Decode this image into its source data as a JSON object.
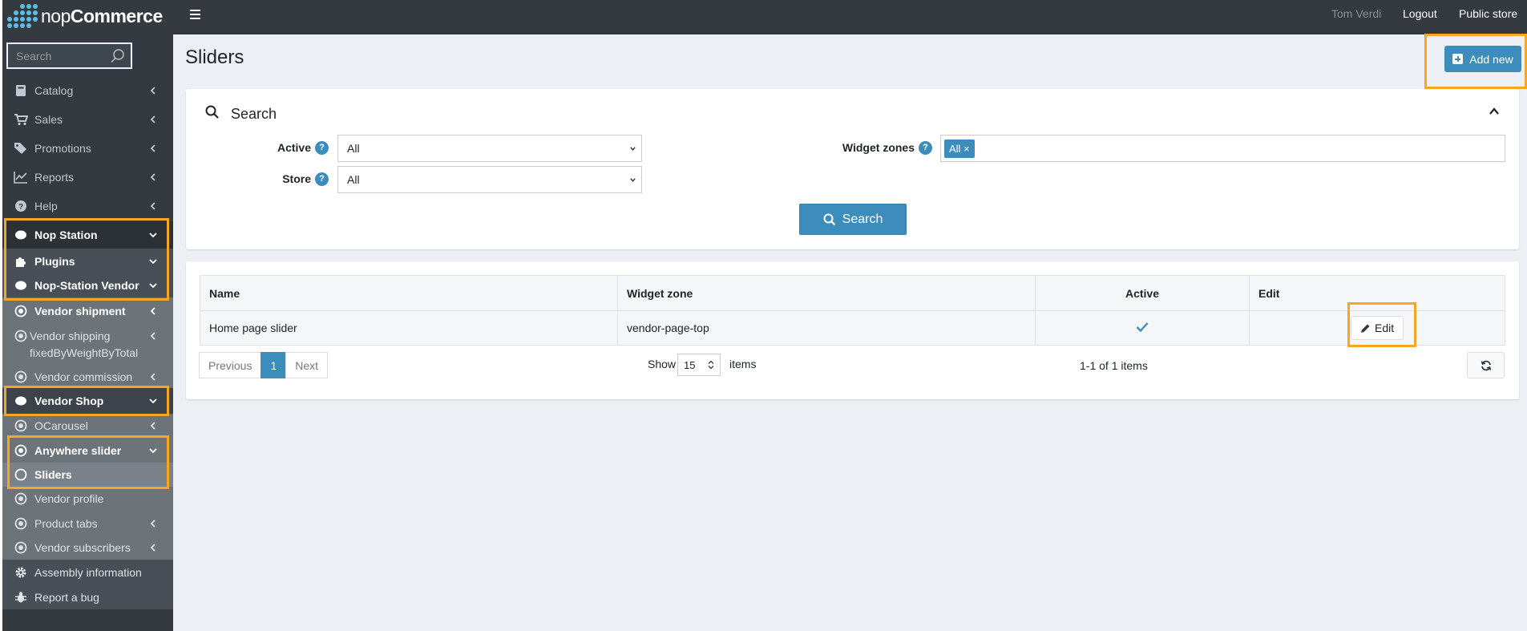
{
  "brand": {
    "logo_light": "nop",
    "logo_bold": "Commerce"
  },
  "sidebar": {
    "search_placeholder": "Search",
    "items": [
      {
        "label": "Catalog",
        "icon": "book-icon"
      },
      {
        "label": "Sales",
        "icon": "cart-icon"
      },
      {
        "label": "Promotions",
        "icon": "tags-icon"
      },
      {
        "label": "Reports",
        "icon": "chart-line-icon"
      },
      {
        "label": "Help",
        "icon": "question-circle-icon"
      },
      {
        "label": "Nop Station",
        "icon": "cloud-icon"
      },
      {
        "label": "Plugins",
        "icon": "puzzle-icon"
      },
      {
        "label": "Nop-Station Vendor",
        "icon": "cloud-icon"
      },
      {
        "label": "Vendor shipment",
        "icon": "dot-circle-icon"
      },
      {
        "label": "Vendor shipping",
        "label2": "fixedByWeightByTotal",
        "icon": "dot-circle-icon"
      },
      {
        "label": "Vendor commission",
        "icon": "dot-circle-icon"
      },
      {
        "label": "Vendor Shop",
        "icon": "cloud-icon"
      },
      {
        "label": "OCarousel",
        "icon": "dot-circle-icon"
      },
      {
        "label": "Anywhere slider",
        "icon": "dot-circle-icon"
      },
      {
        "label": "Sliders",
        "icon": "circle-icon"
      },
      {
        "label": "Vendor profile",
        "icon": "dot-circle-icon"
      },
      {
        "label": "Product tabs",
        "icon": "dot-circle-icon"
      },
      {
        "label": "Vendor subscribers",
        "icon": "dot-circle-icon"
      },
      {
        "label": "Assembly information",
        "icon": "gear-icon"
      },
      {
        "label": "Report a bug",
        "icon": "bug-icon"
      }
    ]
  },
  "topbar": {
    "user": "Tom Verdi",
    "logout": "Logout",
    "public_store": "Public store"
  },
  "page": {
    "title": "Sliders",
    "add_new": "Add new"
  },
  "search": {
    "title": "Search",
    "active_label": "Active",
    "active_value": "All",
    "store_label": "Store",
    "store_value": "All",
    "widget_zones_label": "Widget zones",
    "widget_zones_tag": "All ×",
    "button": "Search"
  },
  "grid": {
    "headers": [
      "Name",
      "Widget zone",
      "Active",
      "Edit"
    ],
    "rows": [
      {
        "name": "Home page slider",
        "widget_zone": "vendor-page-top",
        "active": true,
        "edit": "Edit"
      }
    ],
    "pager": {
      "previous": "Previous",
      "current": "1",
      "next": "Next"
    },
    "show_label": "Show",
    "page_size": "15",
    "items_label": "items",
    "summary": "1-1 of 1 items"
  },
  "colors": {
    "accent": "#3c8dbc",
    "highlight": "#f5a623",
    "sidebar": "#343a40"
  }
}
